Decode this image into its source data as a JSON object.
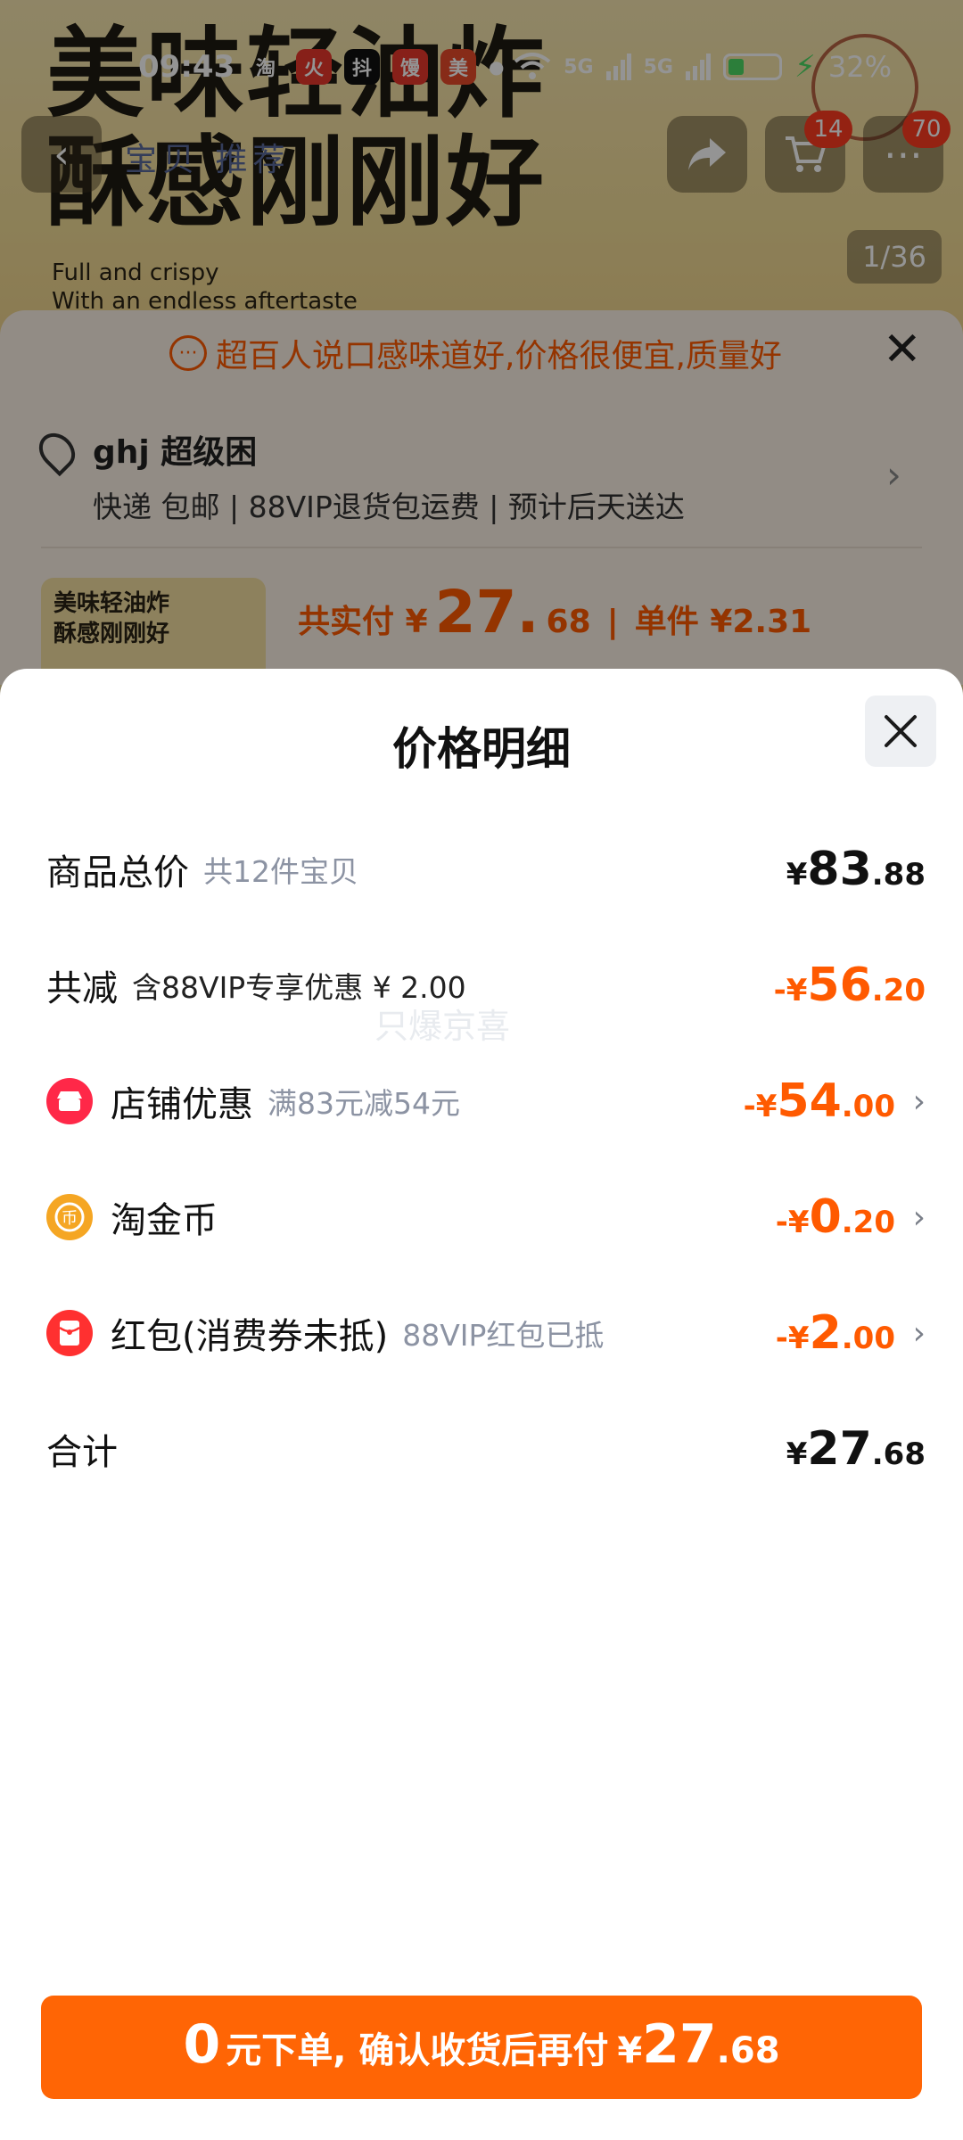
{
  "status_bar": {
    "time": "09:43",
    "apps": [
      "淘",
      "火",
      "抖",
      "馒",
      "美"
    ],
    "network_1": "5G",
    "network_2": "5G",
    "battery": "32%",
    "battery_level": 0.32
  },
  "background": {
    "banner_line_1": "美味轻油炸",
    "banner_line_2": "酥感刚刚好",
    "banner_en_1": "Full and crispy",
    "banner_en_2": "With an endless aftertaste",
    "nav_tabs": "宝贝  推荐",
    "cart_badge": "14",
    "more_badge": "70",
    "page_counter": "1/36",
    "hint": "超百人说口感味道好,价格很便宜,质量好",
    "address_name": "ghj 超级困",
    "address_sub": "快递 包邮 | 88VIP退货包运费 | 预计后天送达",
    "thumb_line_1": "美味轻油炸",
    "thumb_line_2": "酥感刚刚好",
    "pay_label": "共实付 ¥",
    "pay_int": "27.",
    "pay_dec": "68",
    "unit_price": "单件 ¥2.31"
  },
  "sheet": {
    "title": "价格明细",
    "watermark": "只爆京喜",
    "rows": [
      {
        "label": "商品总价",
        "sub": "共12件宝贝",
        "sym": "¥",
        "int": "83",
        "dec": ".88"
      },
      {
        "label": "共减",
        "sub": "含88VIP专享优惠 ¥ 2.00",
        "sym": "-¥",
        "int": "56",
        "dec": ".20"
      },
      {
        "label": "店铺优惠",
        "sub": "满83元减54元",
        "sym": "-¥",
        "int": "54",
        "dec": ".00"
      },
      {
        "label": "淘金币",
        "sub": "",
        "sym": "-¥",
        "int": "0",
        "dec": ".20"
      },
      {
        "label": "红包(消费券未抵)",
        "sub": "88VIP红包已抵",
        "sym": "-¥",
        "int": "2",
        "dec": ".00"
      },
      {
        "label": "合计",
        "sub": "",
        "sym": "¥",
        "int": "27",
        "dec": ".68"
      }
    ],
    "colors": {
      "accent": "#ff6505",
      "discount": "#ff5a00",
      "shop_icon": "#ff2848",
      "coin_icon": "#f5a623",
      "redpacket_icon": "#ff3030"
    }
  },
  "cta": {
    "zero": "0",
    "text": "元下单, 确认收货后再付",
    "sym": "¥",
    "int": "27",
    "dec": ".68"
  }
}
